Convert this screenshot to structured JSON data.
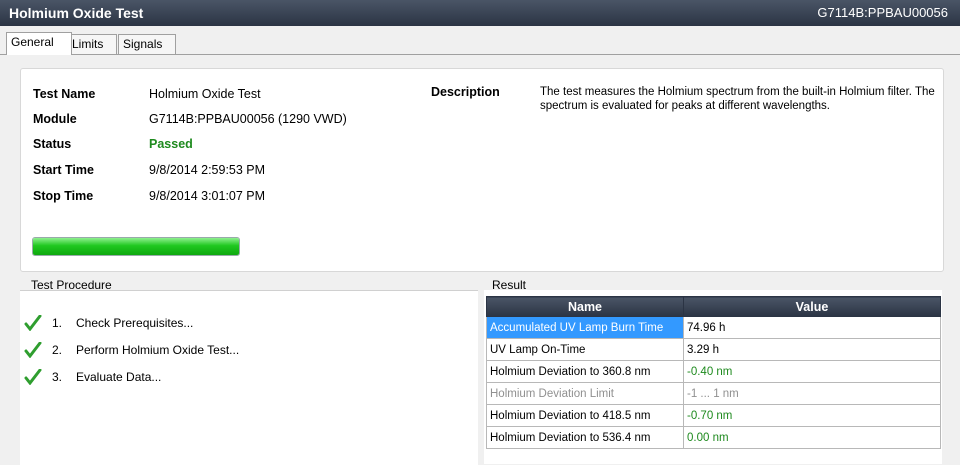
{
  "window": {
    "title": "Holmium Oxide Test",
    "id": "G7114B:PPBAU00056"
  },
  "tabs": [
    {
      "label": "General"
    },
    {
      "label": "Limits"
    },
    {
      "label": "Signals"
    }
  ],
  "info": {
    "test_name_label": "Test Name",
    "test_name": "Holmium Oxide Test",
    "module_label": "Module",
    "module": "G7114B:PPBAU00056 (1290 VWD)",
    "status_label": "Status",
    "status": "Passed",
    "start_label": "Start Time",
    "start": "9/8/2014 2:59:53 PM",
    "stop_label": "Stop Time",
    "stop": "9/8/2014 3:01:07 PM",
    "description_label": "Description",
    "description": "The test measures the Holmium spectrum from the built-in Holmium filter. The spectrum is evaluated for peaks at different wavelengths.",
    "progress": 1.0
  },
  "procedure": {
    "title": "Test Procedure",
    "steps": [
      {
        "num": "1.",
        "label": "Check Prerequisites..."
      },
      {
        "num": "2.",
        "label": "Perform Holmium Oxide Test..."
      },
      {
        "num": "3.",
        "label": "Evaluate Data..."
      }
    ]
  },
  "result": {
    "title": "Result",
    "headers": {
      "name": "Name",
      "value": "Value"
    },
    "rows": [
      {
        "name": "Accumulated UV Lamp Burn Time",
        "value": "74.96 h"
      },
      {
        "name": "UV Lamp On-Time",
        "value": "3.29 h"
      },
      {
        "name": "Holmium Deviation to 360.8 nm",
        "value": "-0.40 nm"
      },
      {
        "name": "Holmium Deviation Limit",
        "value": "-1 ... 1 nm"
      },
      {
        "name": "Holmium Deviation to 418.5 nm",
        "value": "-0.70 nm"
      },
      {
        "name": "Holmium Deviation to 536.4 nm",
        "value": "0.00 nm"
      }
    ]
  },
  "colors": {
    "accent": "#3399ff",
    "pass_green": "#1e8a1e",
    "header_dark": "#2b3444"
  }
}
